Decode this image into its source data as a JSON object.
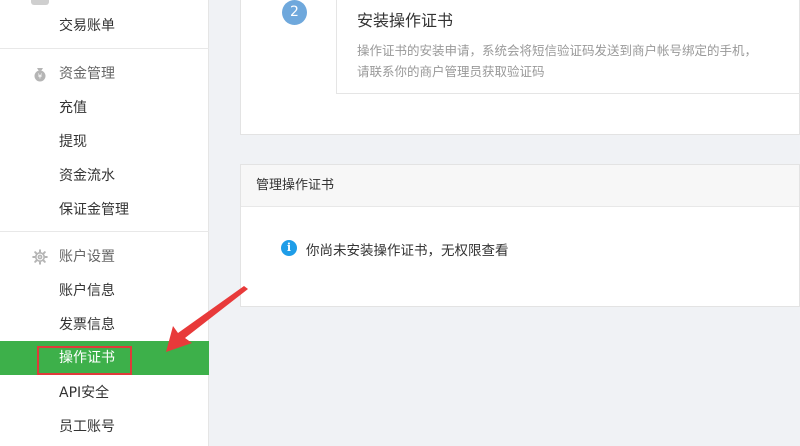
{
  "sidebar": {
    "items": {
      "trade_bill": "交易账单",
      "recharge": "充值",
      "withdraw": "提现",
      "fund_flow": "资金流水",
      "deposit_manage": "保证金管理",
      "account_info": "账户信息",
      "invoice_info": "发票信息",
      "operation_cert": "操作证书",
      "api_security": "API安全",
      "staff_account": "员工账号"
    },
    "groups": {
      "fund_manage": "资金管理",
      "account_settings": "账户设置"
    },
    "active_color": "#3db04a"
  },
  "step": {
    "number": "2",
    "title": "安装操作证书",
    "desc_line1": "操作证书的安装申请，系统会将短信验证码发送到商户帐号绑定的手机，",
    "desc_line2": "请联系你的商户管理员获取验证码"
  },
  "manage": {
    "title": "管理操作证书",
    "notice": "你尚未安装操作证书，无权限查看",
    "notice_icon": "info-icon"
  },
  "annotation": {
    "highlight_color": "#e03a3a",
    "arrow_color": "#e83a3a"
  }
}
